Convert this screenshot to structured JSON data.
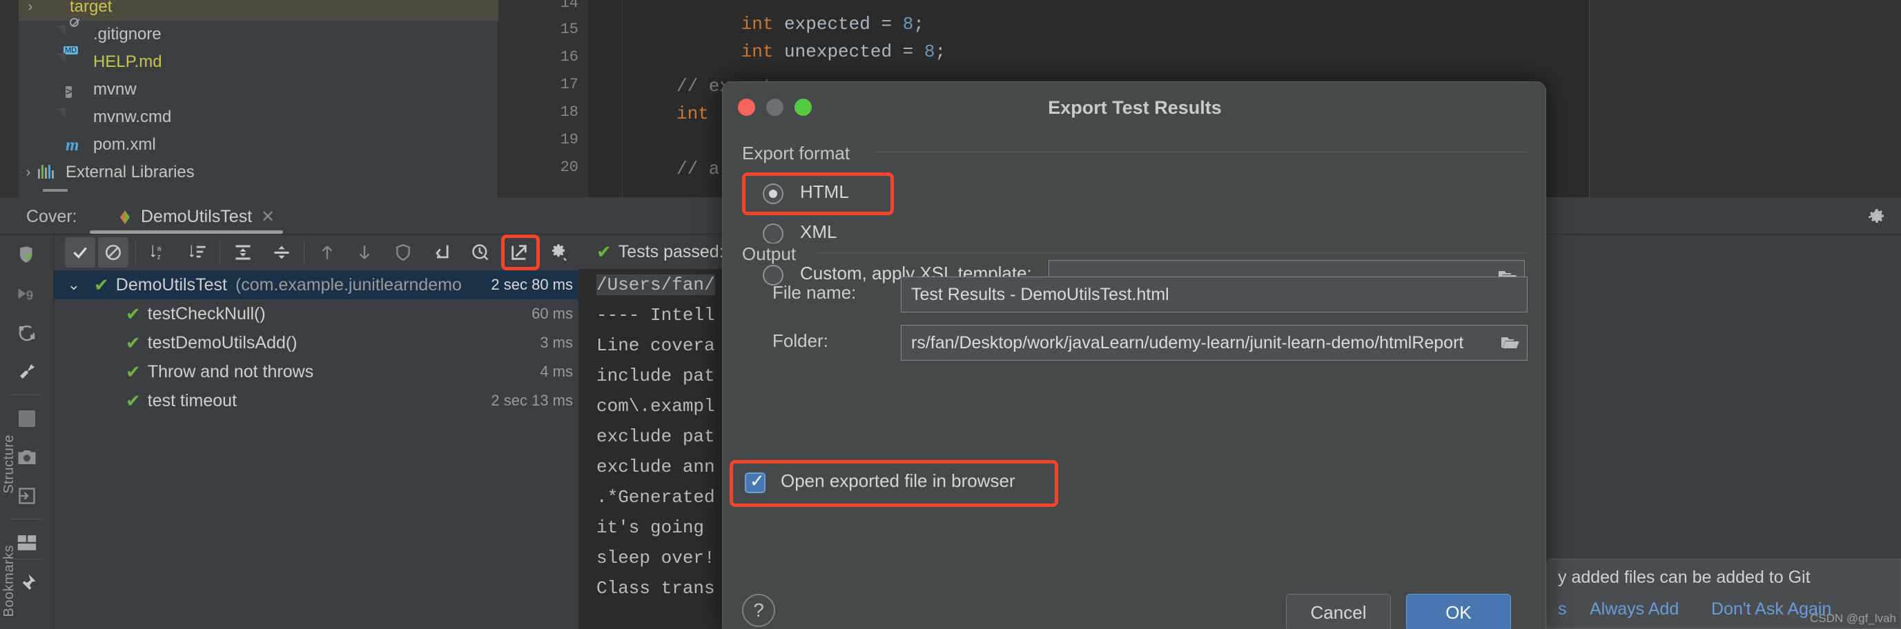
{
  "project_tree": {
    "items": [
      {
        "label": "target",
        "icon": "folder-icon",
        "arrow": "›",
        "selected": true,
        "indent": 46,
        "color": "yellow"
      },
      {
        "label": ".gitignore",
        "icon": "gitignore-file-icon",
        "arrow": "",
        "selected": false,
        "indent": 80,
        "color": "grey"
      },
      {
        "label": "HELP.md",
        "icon": "markdown-file-icon",
        "arrow": "",
        "selected": false,
        "indent": 80,
        "color": "yellow"
      },
      {
        "label": "mvnw",
        "icon": "shell-script-icon",
        "arrow": "",
        "selected": false,
        "indent": 80,
        "color": "grey"
      },
      {
        "label": "mvnw.cmd",
        "icon": "text-file-icon",
        "arrow": "",
        "selected": false,
        "indent": 80,
        "color": "grey"
      },
      {
        "label": "pom.xml",
        "icon": "maven-file-icon",
        "arrow": "",
        "selected": false,
        "indent": 80,
        "color": "grey"
      },
      {
        "label": "External Libraries",
        "icon": "libraries-icon",
        "arrow": "›",
        "selected": false,
        "indent": 12,
        "color": "grey"
      }
    ],
    "md_badge": "MD",
    "shell_glyph": ">"
  },
  "editor": {
    "line_numbers": [
      "14",
      "15",
      "16",
      "17",
      "18",
      "19",
      "20"
    ],
    "lines": [
      {
        "segments": [
          {
            "t": "int ",
            "c": "kw"
          },
          {
            "t": "expected",
            "c": "id"
          },
          {
            "t": " = ",
            "c": "id"
          },
          {
            "t": "8",
            "c": "num"
          },
          {
            "t": ";",
            "c": "id"
          }
        ]
      },
      {
        "segments": [
          {
            "t": "int ",
            "c": "kw"
          },
          {
            "t": "unexpected",
            "c": "id"
          },
          {
            "t": " = ",
            "c": "id"
          },
          {
            "t": "8",
            "c": "num"
          },
          {
            "t": ";",
            "c": "id"
          }
        ]
      },
      {
        "segments": []
      },
      {
        "segments": [
          {
            "t": "// execute",
            "c": "cmt"
          }
        ]
      },
      {
        "segments": [
          {
            "t": "int ",
            "c": "kw"
          }
        ]
      },
      {
        "segments": []
      },
      {
        "segments": [
          {
            "t": "// a",
            "c": "cmt"
          }
        ]
      }
    ]
  },
  "cover_bar": {
    "label": "Cover:",
    "tab_name": "DemoUtilsTest",
    "close_glyph": "✕",
    "gear_name": "settings-gear-icon"
  },
  "left_toolbar": {
    "buttons": [
      {
        "name": "rerun-coverage-icon"
      },
      {
        "name": "rerun-failed-tests-icon"
      },
      {
        "name": "rerun-automatically-icon"
      },
      {
        "name": "configure-wrench-icon"
      },
      {
        "name": "stop-square-icon"
      },
      {
        "name": "screenshot-camera-icon"
      },
      {
        "name": "dump-threads-icon"
      },
      {
        "name": "layout-settings-icon"
      },
      {
        "name": "pin-tab-icon"
      }
    ],
    "side_labels": [
      "Structure",
      "Bookmarks"
    ]
  },
  "test_toolbar": {
    "buttons": [
      {
        "name": "show-passed-tests-toggle",
        "glyph": "✔",
        "active": true,
        "dim": false
      },
      {
        "name": "show-ignored-tests-toggle",
        "glyph": "⌀",
        "active": true,
        "dim": false
      },
      {
        "name": "sort-alphabetically-icon",
        "glyph": "az",
        "active": false,
        "dim": false
      },
      {
        "name": "sort-by-duration-icon",
        "glyph": "dur",
        "active": false,
        "dim": false
      },
      {
        "name": "expand-all-icon",
        "glyph": "exp",
        "active": false,
        "dim": false
      },
      {
        "name": "collapse-all-icon",
        "glyph": "col",
        "active": false,
        "dim": false
      },
      {
        "name": "previous-failed-test-icon",
        "glyph": "↑",
        "active": false,
        "dim": true
      },
      {
        "name": "next-failed-test-icon",
        "glyph": "↓",
        "active": false,
        "dim": true
      },
      {
        "name": "filter-shield-icon",
        "glyph": "shield",
        "active": false,
        "dim": true
      },
      {
        "name": "jump-to-source-icon",
        "glyph": "jump",
        "active": false,
        "dim": false
      },
      {
        "name": "test-history-icon",
        "glyph": "clock",
        "active": false,
        "dim": false
      },
      {
        "name": "export-test-results-icon",
        "glyph": "export",
        "active": false,
        "dim": false,
        "highlighted": true
      },
      {
        "name": "test-settings-gear-icon",
        "glyph": "gear",
        "active": false,
        "dim": false
      }
    ]
  },
  "test_tree": {
    "rows": [
      {
        "name": "DemoUtilsTest",
        "package": "(com.example.junitlearndemo",
        "duration": "2 sec 80 ms",
        "indent": 96,
        "selected": true,
        "expander": "⌄"
      },
      {
        "name": "testCheckNull()",
        "package": "",
        "duration": "60 ms",
        "indent": 158,
        "selected": false,
        "expander": ""
      },
      {
        "name": "testDemoUtilsAdd()",
        "package": "",
        "duration": "3 ms",
        "indent": 158,
        "selected": false,
        "expander": ""
      },
      {
        "name": "Throw and not throws",
        "package": "",
        "duration": "4 ms",
        "indent": 158,
        "selected": false,
        "expander": ""
      },
      {
        "name": "test timeout",
        "package": "",
        "duration": "2 sec 13 ms",
        "indent": 158,
        "selected": false,
        "expander": ""
      }
    ]
  },
  "console": {
    "header": "Tests passed:",
    "lines": [
      {
        "text": "/Users/fan/",
        "highlight": true
      },
      {
        "text": "---- Intell",
        "highlight": false
      },
      {
        "text": "Line covera",
        "highlight": false
      },
      {
        "text": "include pat",
        "highlight": false
      },
      {
        "text": "com\\.exampl",
        "highlight": false
      },
      {
        "text": "exclude pat",
        "highlight": false
      },
      {
        "text": "exclude ann",
        "highlight": false
      },
      {
        "text": ".*Generated",
        "highlight": false
      },
      {
        "text": "it's going ",
        "highlight": false
      },
      {
        "text": "sleep over!",
        "highlight": false
      },
      {
        "text": "Class trans",
        "highlight": false
      }
    ]
  },
  "dialog": {
    "title": "Export Test Results",
    "traffic_lights": [
      "close-button",
      "minimize-button",
      "zoom-button"
    ],
    "export_format": {
      "group_title": "Export format",
      "options": [
        {
          "label": "HTML",
          "selected": true,
          "highlighted": true
        },
        {
          "label": "XML",
          "selected": false,
          "highlighted": false
        },
        {
          "label": "Custom, apply XSL template:",
          "selected": false,
          "highlighted": false
        }
      ],
      "xsl_value": "",
      "xsl_placeholder": ""
    },
    "output": {
      "group_title": "Output",
      "file_name_label": "File name:",
      "file_name_value": "Test Results - DemoUtilsTest.html",
      "folder_label": "Folder:",
      "folder_value": "rs/fan/Desktop/work/javaLearn/udemy-learn/junit-learn-demo/htmlReport"
    },
    "open_in_browser": {
      "label": "Open exported file in browser",
      "checked": true,
      "highlighted": true
    },
    "help_glyph": "?",
    "cancel_label": "Cancel",
    "ok_label": "OK"
  },
  "git_notification": {
    "message": "y added files can be added to Git",
    "links": [
      "s",
      "Always Add",
      "Don't Ask Again"
    ],
    "watermark": "CSDN @gf_lvah"
  },
  "colors": {
    "accent_blue": "#4776b0",
    "highlight_red": "#f5442a",
    "pass_green": "#6cb33f",
    "selection_blue": "#1b3147",
    "folder_orange": "#d4874f"
  }
}
